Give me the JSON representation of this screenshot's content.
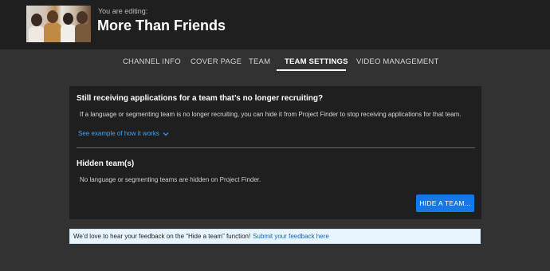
{
  "header": {
    "editing_label": "You are editing:",
    "channel_title": "More Than Friends",
    "thumbnail_icon": "channel-thumbnail"
  },
  "tabs": [
    {
      "label": "CHANNEL INFO",
      "active": false
    },
    {
      "label": "COVER PAGE",
      "active": false
    },
    {
      "label": "TEAM",
      "active": false
    },
    {
      "label": "TEAM SETTINGS",
      "active": true
    },
    {
      "label": "VIDEO MANAGEMENT",
      "active": false
    }
  ],
  "panel": {
    "question_title": "Still receiving applications for a team that’s no longer recruiting?",
    "question_desc": "If a language or segmenting team is no longer recruiting, you can hide it from Project Finder to stop receiving applications for that team.",
    "example_link": "See example of how it works",
    "example_icon": "chevron-down-icon",
    "hidden_title": "Hidden team(s)",
    "hidden_desc": "No language or segmenting teams are hidden on Project Finder.",
    "hide_button": "HIDE A TEAM..."
  },
  "feedback": {
    "text": "We’d love to hear your feedback on the “Hide a team” function!",
    "link": "Submit your feedback here"
  },
  "colors": {
    "accent": "#1677e6",
    "link": "#3ea6ff",
    "background": "#323232",
    "panel": "#1f1f1f"
  }
}
